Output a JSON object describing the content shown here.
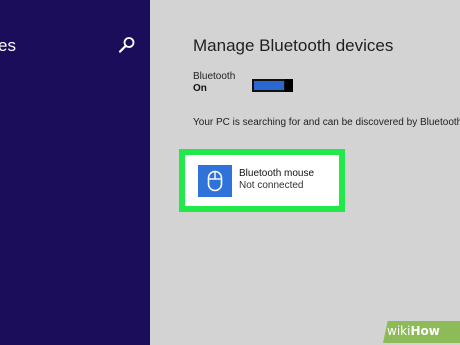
{
  "sidebar": {
    "title": "es",
    "search_icon": "search-icon"
  },
  "main": {
    "title": "Manage Bluetooth devices",
    "bluetooth_label": "Bluetooth",
    "bluetooth_state": "On",
    "search_message": "Your PC is searching for and can be discovered by Bluetooth devices."
  },
  "device": {
    "name": "Bluetooth mouse",
    "status": "Not connected",
    "icon": "mouse-icon"
  },
  "watermark": {
    "prefix": "wiki",
    "suffix": "How"
  },
  "colors": {
    "sidebar_bg": "#1c0d5a",
    "main_bg": "#d3d3d3",
    "accent_blue": "#2b67d3",
    "highlight_green": "#22e84a",
    "watermark_green": "#8dbb5a"
  }
}
